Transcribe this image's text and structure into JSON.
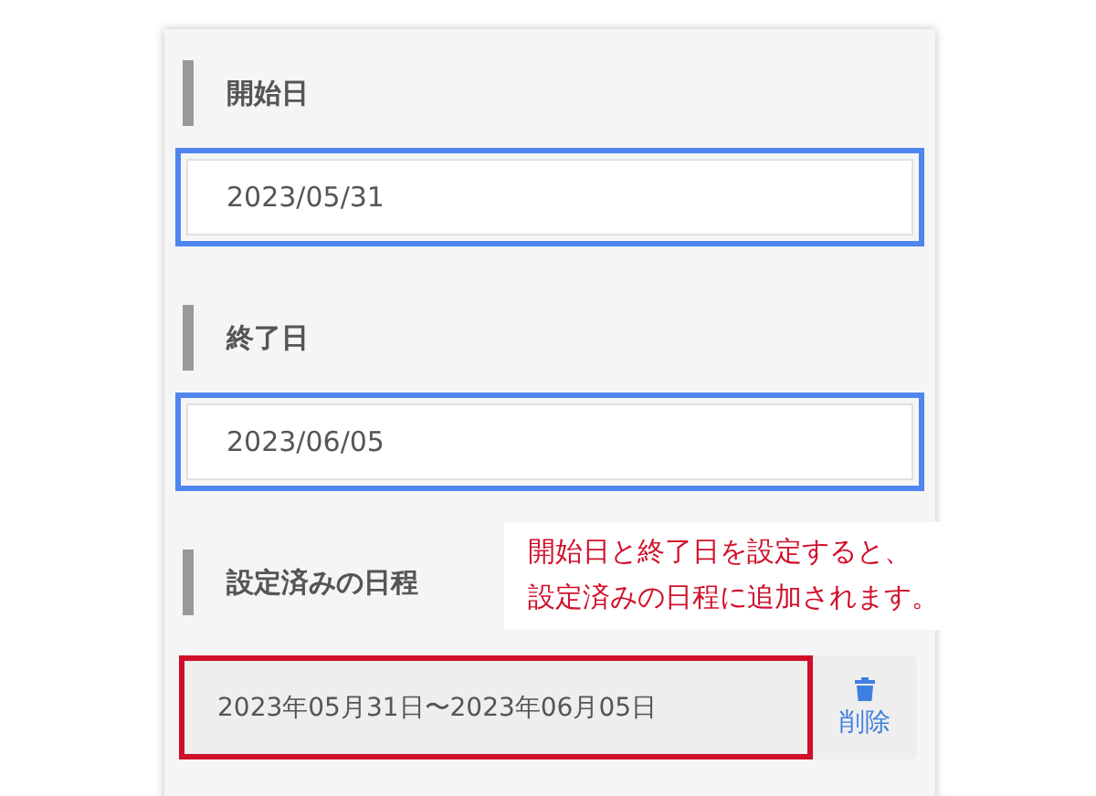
{
  "sections": [
    {
      "kind": "date",
      "heading": "開始日",
      "value": "2023/05/31",
      "highlighted": true
    },
    {
      "kind": "date",
      "heading": "終了日",
      "value": "2023/06/05",
      "highlighted": true
    },
    {
      "kind": "schedule",
      "heading": "設定済みの日程",
      "items": [
        {
          "range": "2023年05月31日〜2023年06月05日",
          "delete_label": "削除",
          "highlighted": true
        }
      ]
    }
  ],
  "callout": {
    "lines": [
      "開始日と終了日を設定すると、",
      "設定済みの日程に追加されます。"
    ]
  }
}
